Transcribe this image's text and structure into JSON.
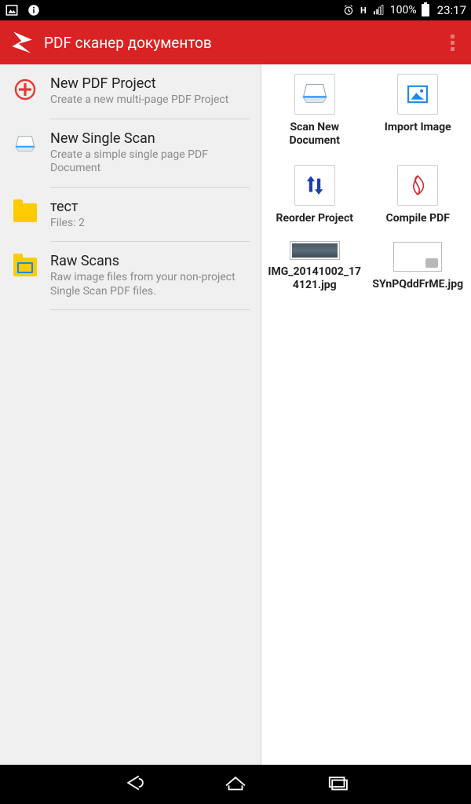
{
  "status": {
    "battery": "100%",
    "time": "23:17",
    "network_indicator": "H"
  },
  "app_bar": {
    "title": "PDF сканер документов"
  },
  "left_list": [
    {
      "title": "New PDF Project",
      "subtitle": "Create a new multi-page PDF Project",
      "icon": "plus"
    },
    {
      "title": "New Single Scan",
      "subtitle": "Create a simple single page PDF Document",
      "icon": "scanner"
    },
    {
      "title": "тест",
      "subtitle": "Files: 2",
      "icon": "folder"
    },
    {
      "title": "Raw Scans",
      "subtitle": "Raw image files from your non-project Single Scan PDF files.",
      "icon": "folder-image"
    }
  ],
  "right_tiles": [
    {
      "label": "Scan New Document",
      "icon": "scanner"
    },
    {
      "label": "Import Image",
      "icon": "image"
    },
    {
      "label": "Reorder Project",
      "icon": "reorder"
    },
    {
      "label": "Compile PDF",
      "icon": "pdf"
    }
  ],
  "right_files": [
    {
      "label": "IMG_20141002_174121.jpg"
    },
    {
      "label": "SYnPQddFrME.jpg"
    }
  ]
}
